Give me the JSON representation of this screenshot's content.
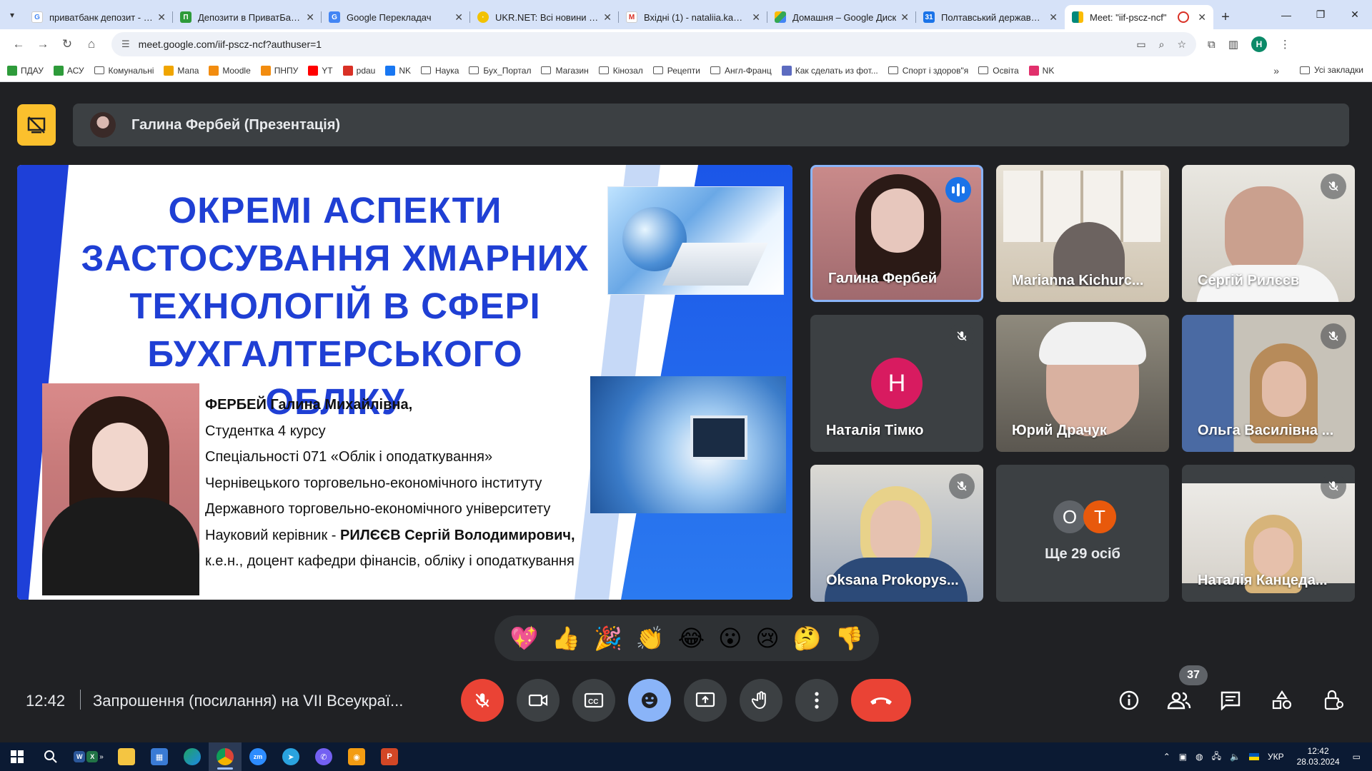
{
  "browser": {
    "tabs": [
      {
        "title": "приватбанк депозит - По",
        "icon_color": "#4285f4",
        "icon": "google-icon"
      },
      {
        "title": "Депозити в ПриватБанку",
        "icon_color": "#2e9b3a",
        "icon": "privatbank-icon"
      },
      {
        "title": "Google Перекладач",
        "icon_color": "#4285f4",
        "icon": "translate-icon"
      },
      {
        "title": "UKR.NET: Всі новини Укр",
        "icon_color": "#f2c200",
        "icon": "ukrnet-icon"
      },
      {
        "title": "Вхідні (1) - nataliia.kantse",
        "icon_color": "#d93025",
        "icon": "gmail-icon"
      },
      {
        "title": "Домашня – Google Диск",
        "icon_color": "#fbbc04",
        "icon": "drive-icon"
      },
      {
        "title": "Полтавський державний",
        "icon_color": "#1a73e8",
        "icon": "calendar-icon"
      },
      {
        "title": "Meet: \"iif-pscz-ncf\"",
        "icon_color": "#00897b",
        "icon": "meet-icon",
        "active": true
      }
    ],
    "url": "meet.google.com/iif-pscz-ncf?authuser=1",
    "profile_initial": "Н",
    "bookmarks": [
      {
        "label": "ПДАУ",
        "icon": "pdau-icon",
        "color": "#2e9b3a"
      },
      {
        "label": "АСУ",
        "icon": "asu-icon",
        "color": "#2e9b3a"
      },
      {
        "label": "Комунальні",
        "icon": "folder-icon"
      },
      {
        "label": "Мапа",
        "icon": "map-icon",
        "color": "#f0a500"
      },
      {
        "label": "Moodle",
        "icon": "moodle-icon",
        "color": "#f28c0f"
      },
      {
        "label": "ПНПУ",
        "icon": "pnpu-icon",
        "color": "#f28c0f"
      },
      {
        "label": "YT",
        "icon": "youtube-icon",
        "color": "#ff0000"
      },
      {
        "label": "pdau",
        "icon": "gmail-icon",
        "color": "#d93025"
      },
      {
        "label": "NK",
        "icon": "facebook-icon",
        "color": "#1877f2"
      },
      {
        "label": "Наука",
        "icon": "folder-icon"
      },
      {
        "label": "Бух_Портал",
        "icon": "folder-icon"
      },
      {
        "label": "Магазин",
        "icon": "folder-icon"
      },
      {
        "label": "Кінозал",
        "icon": "folder-icon"
      },
      {
        "label": "Рецепти",
        "icon": "folder-icon"
      },
      {
        "label": "Англ-Франц",
        "icon": "folder-icon"
      },
      {
        "label": "Как сделать из фот...",
        "icon": "page-icon",
        "color": "#5c6bc0"
      },
      {
        "label": "Спорт і здоров\"я",
        "icon": "folder-icon"
      },
      {
        "label": "Освіта",
        "icon": "folder-icon"
      },
      {
        "label": "NK",
        "icon": "instagram-icon",
        "color": "#e1306c"
      }
    ],
    "all_bookmarks": "Усі закладки"
  },
  "meet": {
    "presenter_bar": "Галина Фербей (Презентація)",
    "slide": {
      "title_lines": [
        "ОКРЕМІ АСПЕКТИ",
        "ЗАСТОСУВАННЯ ХМАРНИХ",
        "ТЕХНОЛОГІЙ В СФЕРІ",
        "БУХГАЛТЕРСЬКОГО ОБЛІКУ"
      ],
      "author": "ФЕРБЕЙ Галина Михайлівна,",
      "course": "Студентка 4 курсу",
      "specialty": "Спеціальності 071 «Облік і оподаткування»",
      "institute": "Чернівецького торговельно-економічного інституту",
      "university": "Державного торговельно-економічного університету",
      "advisor_prefix": "Науковий керівник - ",
      "advisor_name": "РИЛЄЄВ Сергій Володимирович,",
      "advisor_title": "к.е.н., доцент кафедри фінансів, обліку і оподаткування"
    },
    "participants": [
      {
        "name": "Галина Фербей",
        "speaking": true
      },
      {
        "name": "Marianna Kichurc...",
        "muted": false
      },
      {
        "name": "Сергій Рилєєв",
        "muted": true
      },
      {
        "name": "Наталія Тімко",
        "muted": true,
        "initial": "Н",
        "avatar_color": "#d81b60"
      },
      {
        "name": "Юрий Драчук",
        "muted": false
      },
      {
        "name": "Ольга Василівна ...",
        "muted": true
      },
      {
        "name": "Oksana Prokopys...",
        "muted": true
      },
      {
        "name": "Наталія Канцеда...",
        "muted": true
      }
    ],
    "more_tile": {
      "label": "Ще 29 осіб",
      "initials": [
        "O",
        "Т"
      ],
      "colors": [
        "#5f6368",
        "#e8590c"
      ]
    },
    "reactions": [
      "💖",
      "👍",
      "🎉",
      "👏",
      "😂",
      "😮",
      "😢",
      "🤔",
      "👎"
    ],
    "time": "12:42",
    "meeting_title": "Запрошення (посилання) на VII Всеукраї...",
    "participant_count": "37"
  },
  "taskbar": {
    "lang": "УКР",
    "time": "12:42",
    "date": "28.03.2024"
  }
}
